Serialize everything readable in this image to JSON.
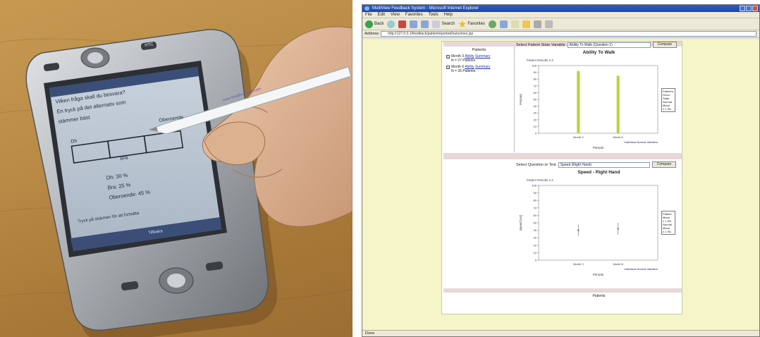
{
  "device": {
    "brand": "HTC",
    "screen_question": "Vilken fråga skall du besvara?",
    "screen_line2": "En tryck på det alternativ som",
    "screen_line3": "stämmer bäst",
    "screen_label_left": "Dh",
    "screen_label_right": "Oberoende",
    "screen_label_mid": "Bra",
    "stat1": "Dh: 30 %",
    "stat2": "Bra: 25 %",
    "stat3": "Oberoende: 45 %",
    "footer_text": "Tryck på skärmen för att fortsätta",
    "softkey": "Tillbaka",
    "stylus_text": "www.healthrelated.com"
  },
  "browser": {
    "title": "MultiView Feedback System - Microsoft Internet Explorer",
    "menu": [
      "File",
      "Edit",
      "View",
      "Favorites",
      "Tools",
      "Help"
    ],
    "toolbar": {
      "back": "Back",
      "search": "Search",
      "favorites": "Favorites"
    },
    "address_label": "Address",
    "address_value": "http://127.0.0.1/feedback/patientreported/outcomes.jsp",
    "status": "Done"
  },
  "page": {
    "sidebar_header": "Patients",
    "cohorts": [
      {
        "label": "Month 3",
        "links": [
          "Ability",
          "Summary"
        ],
        "count": "N = 27 Patients"
      },
      {
        "label": "Month 6",
        "links": [
          "Ability",
          "Summary"
        ],
        "count": "N = 35 Patients"
      }
    ],
    "top_select_label": "Select Patient State Variable",
    "top_select_value": "Ability To Walk (Question 1)",
    "bottom_select_label": "Select Question or Test",
    "bottom_select_value": "Speed (Right Hand)",
    "compare_label": "Compare",
    "bottom_caption": "Patients"
  },
  "charts": {
    "bar_color": "#b7d33a",
    "line_color": "#8a8a8a",
    "chart_data": [
      {
        "type": "bar",
        "title": "Ability To Walk",
        "subtitle": "Patient Results 2.3",
        "ylabel": "Percent",
        "xlabel": "Periods",
        "categories": [
          "Month 3",
          "Month 6"
        ],
        "values": [
          92,
          85
        ],
        "ylim": [
          0,
          100
        ],
        "yticks": [
          0,
          10,
          20,
          30,
          40,
          50,
          60,
          70,
          80,
          90,
          100
        ],
        "legend": [
          "Patient's",
          "Good State",
          "Normal Mean",
          "± 1 SD"
        ],
        "footnote": "Individual Normal Variation"
      },
      {
        "type": "bar",
        "title": "Speed - Right Hand",
        "subtitle": "Patient Results 2.4",
        "ylabel": "Speed (Hz)",
        "xlabel": "Periods",
        "categories": [
          "Month 3",
          "Month 6"
        ],
        "values": [
          40,
          42
        ],
        "ylim": [
          0,
          100
        ],
        "yticks": [
          0,
          10,
          20,
          30,
          40,
          50,
          60,
          70,
          80,
          90,
          100
        ],
        "legend": [
          "Patient Mean",
          "± 1 SD",
          "Normal Mean",
          "± 1 SD"
        ],
        "footnote": "Individual Normal Variation"
      }
    ]
  }
}
